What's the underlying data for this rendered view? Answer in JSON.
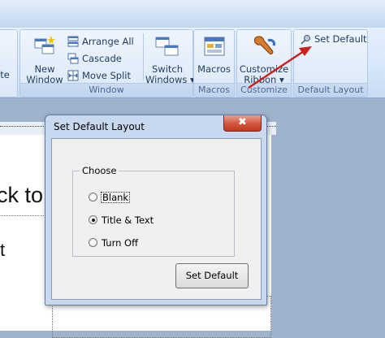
{
  "ribbon": {
    "partial_label": "ite",
    "new_window": {
      "line1": "New",
      "line2": "Window"
    },
    "arrange_all": "Arrange All",
    "cascade": "Cascade",
    "move_split": "Move Split",
    "switch_windows": {
      "line1": "Switch",
      "line2": "Windows ▾"
    },
    "window_group": "Window",
    "macros": "Macros",
    "macros_group": "Macros",
    "customize_ribbon": {
      "line1": "Customize",
      "line2": "Ribbon ▾"
    },
    "customize_group": "Customize",
    "set_default": "Set Default",
    "default_layout_group": "Default Layout"
  },
  "document": {
    "visible_text_1": "ck to",
    "visible_text_2": "t"
  },
  "dialog": {
    "title": "Set Default Layout",
    "close_glyph": "✖",
    "group_label": "Choose",
    "options": [
      {
        "label": "Blank",
        "selected": false
      },
      {
        "label": "Title & Text",
        "selected": true
      },
      {
        "label": "Turn Off",
        "selected": false
      }
    ],
    "button": "Set Default"
  },
  "colors": {
    "arrow": "#cc1f1f",
    "accent": "#1e3a5f"
  }
}
